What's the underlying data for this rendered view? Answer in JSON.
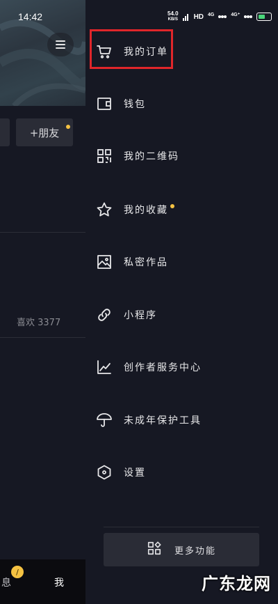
{
  "status_bar": {
    "time": "14:42",
    "net_speed_value": "54.0",
    "net_speed_unit": "KB/S",
    "hd": "HD",
    "sig1": "4G",
    "sig2": "4G⁺"
  },
  "background": {
    "add_friend_label": "+朋友",
    "likes_text": "喜欢 3377",
    "tab_message": "息",
    "tab_me": "我"
  },
  "drawer": {
    "items": [
      {
        "label": "我的订单",
        "icon": "cart-icon",
        "dot": false
      },
      {
        "label": "钱包",
        "icon": "wallet-icon",
        "dot": false
      },
      {
        "label": "我的二维码",
        "icon": "qr-code-icon",
        "dot": false
      },
      {
        "label": "我的收藏",
        "icon": "star-icon",
        "dot": true
      },
      {
        "label": "私密作品",
        "icon": "image-icon",
        "dot": false
      },
      {
        "label": "小程序",
        "icon": "link-icon",
        "dot": false
      },
      {
        "label": "创作者服务中心",
        "icon": "chart-line-icon",
        "dot": false
      },
      {
        "label": "未成年保护工具",
        "icon": "umbrella-icon",
        "dot": false
      },
      {
        "label": "设置",
        "icon": "hexagon-settings-icon",
        "dot": false
      }
    ],
    "more_label": "更多功能"
  },
  "watermark": "广东龙网",
  "colors": {
    "background": "#161823",
    "accent_dot": "#f5c242",
    "highlight_border": "#e0262a",
    "button_bg": "#2a2c36"
  }
}
